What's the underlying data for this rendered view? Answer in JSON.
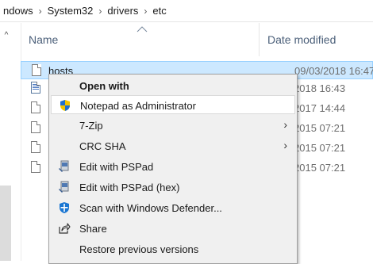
{
  "breadcrumb": {
    "items": [
      "ndows",
      "System32",
      "drivers",
      "etc"
    ],
    "separator": "›"
  },
  "columns": {
    "name": "Name",
    "date_modified": "Date modified"
  },
  "files": [
    {
      "name": "hosts",
      "date": "09/03/2018 16:47",
      "icon": "file-icon",
      "selected": true
    },
    {
      "name": "",
      "date": "2018 16:43",
      "icon": "system-file-icon",
      "selected": false
    },
    {
      "name": "",
      "date": "2017 14:44",
      "icon": "file-icon",
      "selected": false
    },
    {
      "name": "",
      "date": "2015 07:21",
      "icon": "file-icon",
      "selected": false
    },
    {
      "name": "",
      "date": "2015 07:21",
      "icon": "file-icon",
      "selected": false
    },
    {
      "name": "",
      "date": "2015 07:21",
      "icon": "file-icon",
      "selected": false
    }
  ],
  "context_menu": {
    "items": [
      {
        "label": "Open with",
        "bold": true,
        "icon": null,
        "submenu": false
      },
      {
        "label": "Notepad as Administrator",
        "bold": false,
        "icon": "uac-shield-icon",
        "submenu": false,
        "hover": true
      },
      {
        "label": "7-Zip",
        "bold": false,
        "icon": null,
        "submenu": true
      },
      {
        "label": "CRC SHA",
        "bold": false,
        "icon": null,
        "submenu": true
      },
      {
        "label": "Edit with PSPad",
        "bold": false,
        "icon": "pspad-icon",
        "submenu": false
      },
      {
        "label": "Edit with PSPad (hex)",
        "bold": false,
        "icon": "pspad-icon",
        "submenu": false
      },
      {
        "label": "Scan with Windows Defender...",
        "bold": false,
        "icon": "defender-icon",
        "submenu": false
      },
      {
        "label": "Share",
        "bold": false,
        "icon": "share-icon",
        "submenu": false
      },
      {
        "label": "Restore previous versions",
        "bold": false,
        "icon": null,
        "submenu": false
      }
    ],
    "submenu_glyph": "›"
  },
  "colors": {
    "selection_bg": "#cce8ff",
    "selection_border": "#99d1ff",
    "header_text": "#4c607a",
    "menu_bg": "#f0f0f0",
    "shield_blue": "#1f6fd1",
    "shield_yellow": "#f2c300"
  }
}
